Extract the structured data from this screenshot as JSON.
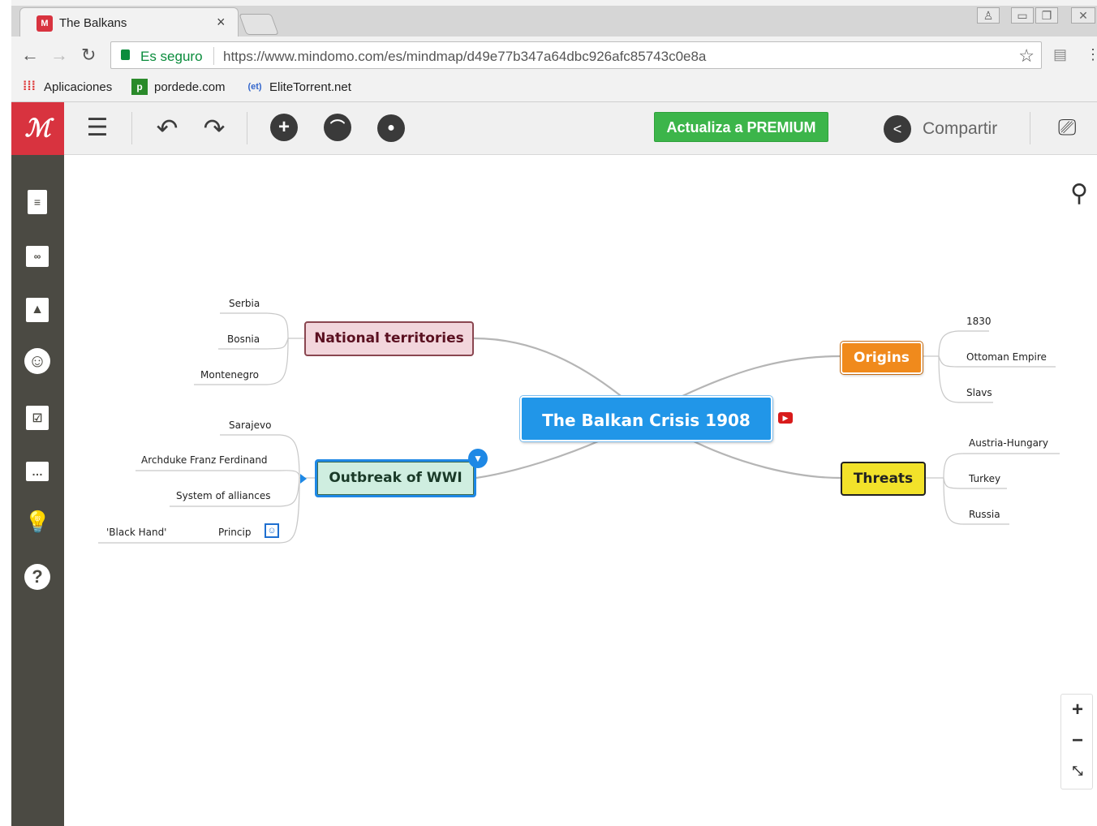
{
  "browser": {
    "tab_title": "The Balkans",
    "tab_close": "×",
    "secure_label": "Es seguro",
    "url": "https://www.mindomo.com/es/mindmap/d49e77b347a64dbc926afc85743c0e8a",
    "bookmarks": [
      {
        "label": "Aplicaciones",
        "icon": "apps-grid-icon"
      },
      {
        "label": "pordede.com",
        "icon": "pordede-icon"
      },
      {
        "label": "EliteTorrent.net",
        "icon": "elitetorrent-icon"
      }
    ]
  },
  "toolbar": {
    "premium_label": "Actualiza a PREMIUM",
    "share_label": "Compartir"
  },
  "mindmap": {
    "central": {
      "label": "The Balkan Crisis 1908",
      "color": "#2196e8"
    },
    "topics": [
      {
        "label": "National territories",
        "color": "#f2d6dc",
        "children": [
          "Serbia",
          "Bosnia",
          "Montenegro"
        ]
      },
      {
        "label": "Outbreak of WWI",
        "color": "#cfeee0",
        "children": [
          "Sarajevo",
          "Archduke Franz Ferdinand",
          "System of alliances",
          "Princip"
        ]
      },
      {
        "label": "Origins",
        "color": "#f08a1c",
        "children": [
          "1830",
          "Ottoman Empire",
          "Slavs"
        ]
      },
      {
        "label": "Threats",
        "color": "#f2e22a",
        "children": [
          "Austria-Hungary",
          "Turkey",
          "Russia"
        ]
      }
    ],
    "sub_leaf": "'Black Hand'"
  },
  "colors": {
    "brand": "#d8333f",
    "sidebar": "#4b4a43",
    "premium": "#3cb54a",
    "selection": "#1e88e5"
  }
}
